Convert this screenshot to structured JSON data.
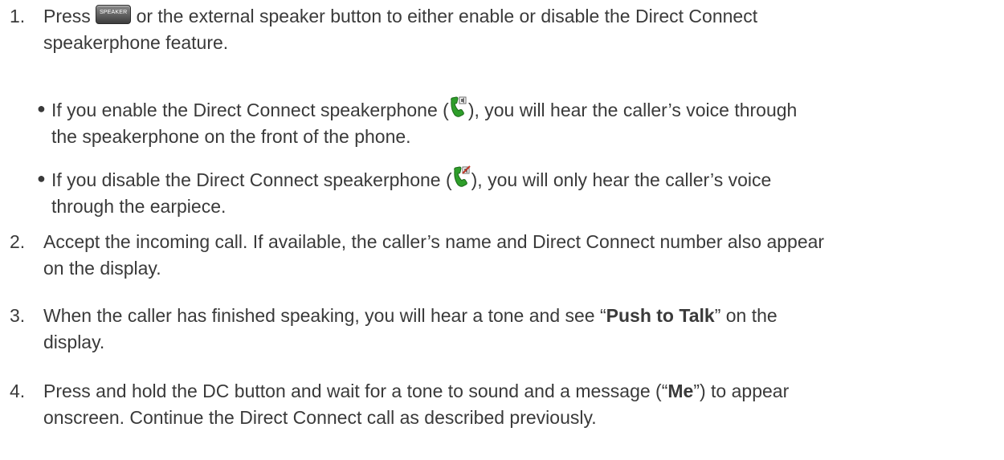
{
  "steps": [
    {
      "number": "1.",
      "line1_before": "Press",
      "line1_after": "or the external speaker button to either enable or disable the Direct Connect",
      "line2": "speakerphone feature.",
      "key_label": "SPEAKER",
      "bullets": [
        {
          "line1_before": "If you enable the Direct Connect speakerphone (",
          "line1_after": "), you will hear the caller’s voice through",
          "line2": "the speakerphone on the front of the phone.",
          "icon": "speakerphone-on-icon"
        },
        {
          "line1_before": "If you disable the Direct Connect speakerphone (",
          "line1_after": "), you will only hear the caller’s voice",
          "line2": "through the earpiece.",
          "icon": "speakerphone-off-icon"
        }
      ]
    },
    {
      "number": "2.",
      "line1": "Accept the incoming call. If available, the caller’s name and Direct Connect number also appear",
      "line2": "on the display."
    },
    {
      "number": "3.",
      "line1_before": "When the caller has finished speaking, you will hear a tone and see “",
      "line1_bold": "Push to Talk",
      "line1_after": "” on the",
      "line2": "display."
    },
    {
      "number": "4.",
      "line1_before": "Press and hold the DC button and wait for a tone to sound and a message (“",
      "line1_bold": "Me",
      "line1_after": "”) to appear",
      "line2": "onscreen. Continue the Direct Connect call as described previously."
    }
  ],
  "colors": {
    "text": "#3a3a3a",
    "icon_green": "#2e9e2a",
    "icon_off_red": "#c0392b"
  }
}
